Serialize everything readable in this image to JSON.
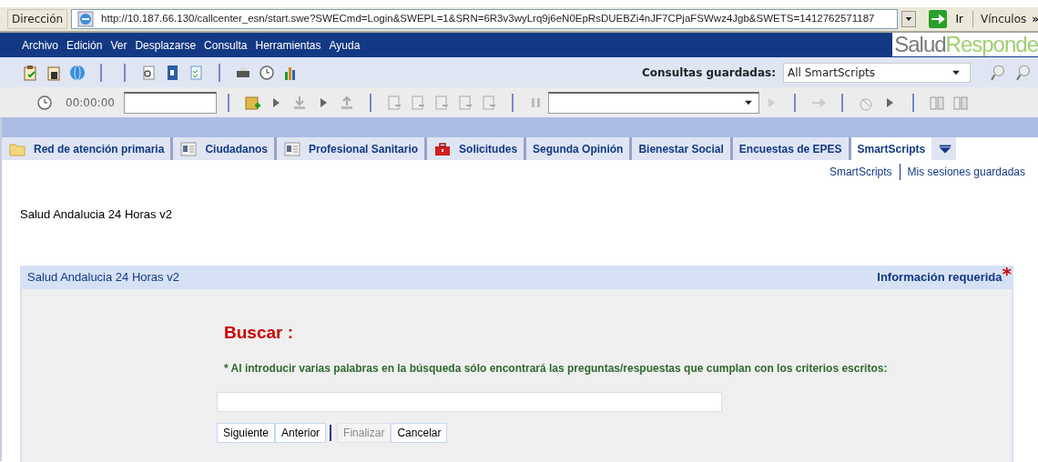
{
  "address_bar": {
    "label": "Dirección",
    "url": "http://10.187.66.130/callcenter_esn/start.swe?SWECmd=Login&SWEPL=1&SRN=6R3v3wyLrq9j6eN0EpRsDUEBZi4nJF7CPjaFSWwz4Jgb&SWETS=1412762571187",
    "go_button": "Ir",
    "links_label": "Vínculos",
    "links_more": "»"
  },
  "menu": [
    "Archivo",
    "Edición",
    "Ver",
    "Desplazarse",
    "Consulta",
    "Herramientas",
    "Ayuda"
  ],
  "logo": {
    "part_1": "Salud",
    "part_2": "Responde"
  },
  "toolbar": {
    "saved_queries_label": "Consultas guardadas:",
    "saved_queries_value": "All SmartScripts"
  },
  "call_toolbar": {
    "timer": "00:00:00"
  },
  "tabs": [
    {
      "label": "Red de atención primaria",
      "kind": "folder",
      "selected": false
    },
    {
      "label": "Ciudadanos",
      "kind": "card",
      "selected": false
    },
    {
      "label": "Profesional Sanitario",
      "kind": "card",
      "selected": false
    },
    {
      "label": "Solicitudes",
      "kind": "toolbox",
      "selected": false
    },
    {
      "label": "Segunda Opinión",
      "kind": "plain",
      "selected": false
    },
    {
      "label": "Bienestar Social",
      "kind": "plain",
      "selected": false
    },
    {
      "label": "Encuestas de EPES",
      "kind": "plain",
      "selected": false
    },
    {
      "label": "SmartScripts",
      "kind": "plain",
      "selected": true
    }
  ],
  "sublinks": [
    "SmartScripts",
    "Mis sesiones guardadas"
  ],
  "page_title": "Salud Andalucia 24 Horas v2",
  "panel": {
    "title": "Salud Andalucia 24 Horas v2",
    "required_label": "Información requerida",
    "required_mark": "*",
    "search_heading": "Buscar :",
    "note": "* Al introducir varias palabras en la búsqueda sólo encontrará las preguntas/respuestas que cumplan con los criterios escritos:",
    "buttons": [
      {
        "label": "Siguiente",
        "disabled": false
      },
      {
        "label": "Anterior",
        "disabled": false
      },
      {
        "label": "Finalizar",
        "disabled": true
      },
      {
        "label": "Cancelar",
        "disabled": false
      }
    ]
  }
}
